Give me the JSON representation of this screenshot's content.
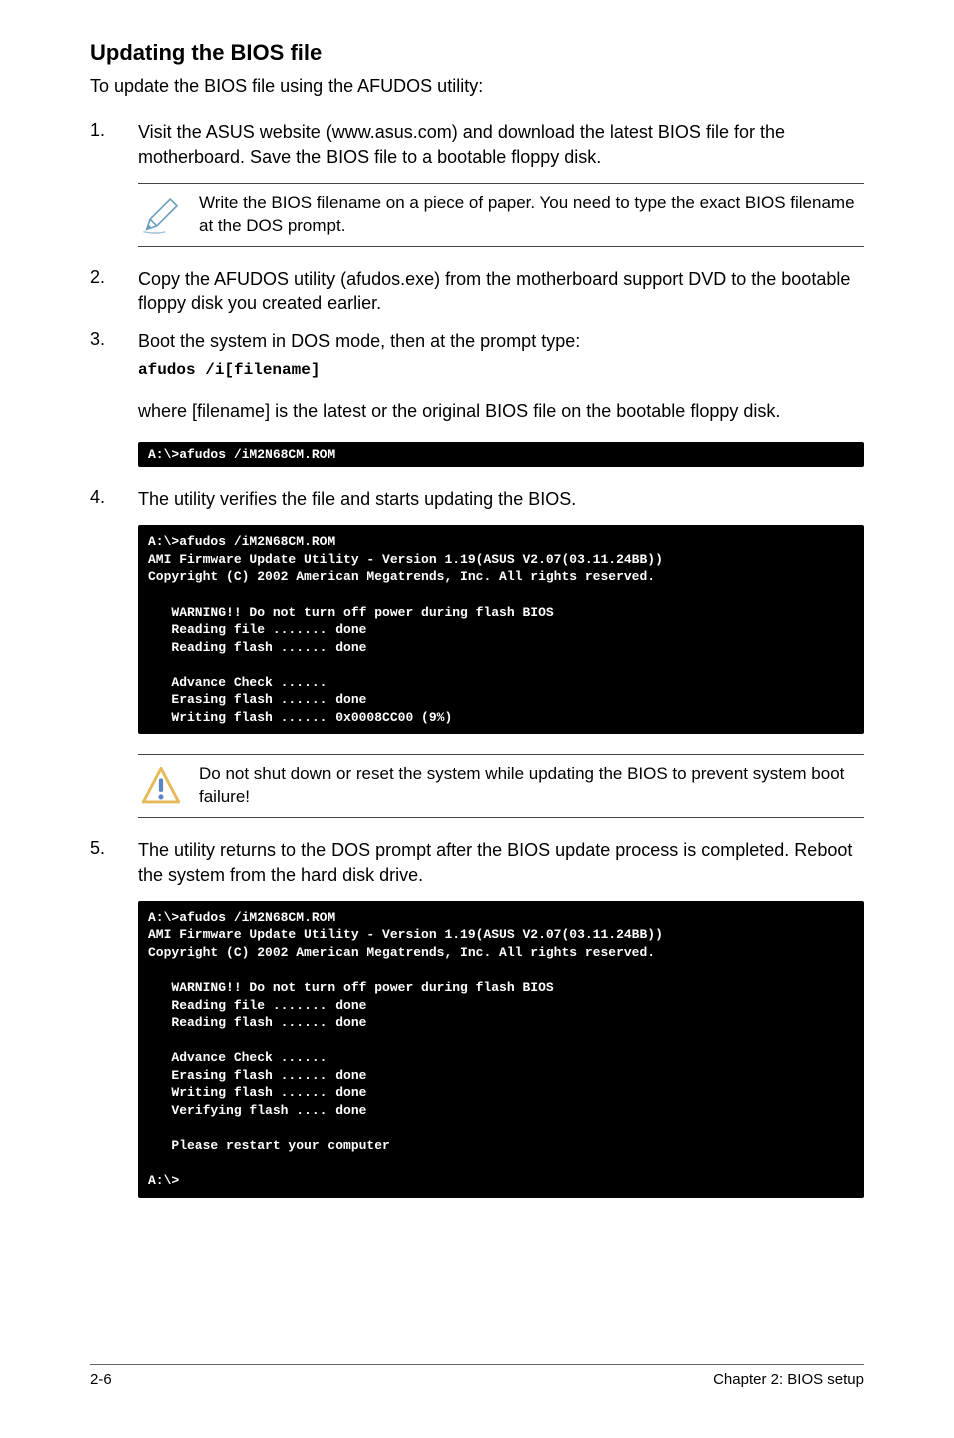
{
  "heading": "Updating the BIOS file",
  "intro": "To update the BIOS file using the AFUDOS utility:",
  "step1": {
    "num": "1.",
    "text": "Visit the ASUS website (www.asus.com) and download the latest BIOS file for the motherboard. Save the BIOS file to a bootable floppy disk."
  },
  "note1": "Write the BIOS filename on a piece of paper. You need to type the exact BIOS filename at the DOS prompt.",
  "step2": {
    "num": "2.",
    "text": "Copy the AFUDOS utility (afudos.exe) from the motherboard support DVD to the bootable floppy disk you created earlier."
  },
  "step3": {
    "num": "3.",
    "text": "Boot the system in DOS mode, then at the prompt type:",
    "cmd": "afudos /i[filename]"
  },
  "step3b": "where [filename] is the latest or the original BIOS file on the bootable floppy disk.",
  "code1": "A:\\>afudos /iM2N68CM.ROM",
  "step4": {
    "num": "4.",
    "text": "The utility verifies the file and starts updating the BIOS."
  },
  "code2": "A:\\>afudos /iM2N68CM.ROM\nAMI Firmware Update Utility - Version 1.19(ASUS V2.07(03.11.24BB))\nCopyright (C) 2002 American Megatrends, Inc. All rights reserved.\n\n   WARNING!! Do not turn off power during flash BIOS\n   Reading file ....... done\n   Reading flash ...... done\n\n   Advance Check ......\n   Erasing flash ...... done\n   Writing flash ...... 0x0008CC00 (9%)",
  "note2": "Do not shut down or reset the system while updating the BIOS to prevent system boot failure!",
  "step5": {
    "num": "5.",
    "text": "The utility returns to the DOS prompt after the BIOS update process is completed. Reboot the system from the hard disk drive."
  },
  "code3": "A:\\>afudos /iM2N68CM.ROM\nAMI Firmware Update Utility - Version 1.19(ASUS V2.07(03.11.24BB))\nCopyright (C) 2002 American Megatrends, Inc. All rights reserved.\n\n   WARNING!! Do not turn off power during flash BIOS\n   Reading file ....... done\n   Reading flash ...... done\n\n   Advance Check ......\n   Erasing flash ...... done\n   Writing flash ...... done\n   Verifying flash .... done\n\n   Please restart your computer\n\nA:\\>",
  "footer": {
    "left": "2-6",
    "right": "Chapter 2: BIOS setup"
  }
}
